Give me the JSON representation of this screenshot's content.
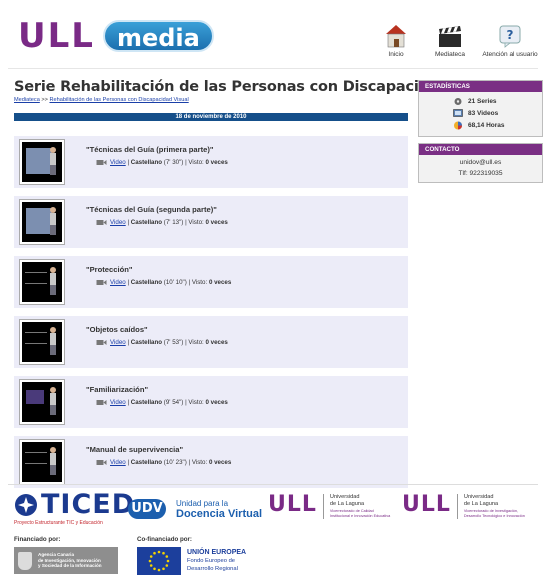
{
  "header": {
    "logo_ull": "ULL",
    "logo_media": "media",
    "nav": [
      {
        "label": "Inicio",
        "icon": "home-icon"
      },
      {
        "label": "Mediateca",
        "icon": "clapperboard-icon"
      },
      {
        "label": "Atención al usuario",
        "icon": "help-icon"
      }
    ]
  },
  "main": {
    "title": "Serie Rehabilitación de las Personas con Discapacidad Visual",
    "breadcrumb": {
      "home": "Mediateca",
      "separator": ">>",
      "current": "Rehabilitación de las Personas con Discapacidad Visual"
    },
    "date": "18 de noviembre de 2010",
    "items": [
      {
        "title": "\"Técnicas del Guía (primera parte)\"",
        "link": "Video",
        "lang": "Castellano",
        "duration": "(7' 30\")",
        "views_label": "Visto:",
        "views": "0 veces",
        "thumb": "thumb-guia-1"
      },
      {
        "title": "\"Técnicas del Guía (segunda parte)\"",
        "link": "Video",
        "lang": "Castellano",
        "duration": "(7' 13\")",
        "views_label": "Visto:",
        "views": "0 veces",
        "thumb": "thumb-guia-2"
      },
      {
        "title": "\"Protección\"",
        "link": "Video",
        "lang": "Castellano",
        "duration": "(10' 10\")",
        "views_label": "Visto:",
        "views": "0 veces",
        "thumb": "thumb-proteccion"
      },
      {
        "title": "\"Objetos caídos\"",
        "link": "Video",
        "lang": "Castellano",
        "duration": "(7' 53\")",
        "views_label": "Visto:",
        "views": "0 veces",
        "thumb": "thumb-objetos"
      },
      {
        "title": "\"Familiarización\"",
        "link": "Video",
        "lang": "Castellano",
        "duration": "(9' 54\")",
        "views_label": "Visto:",
        "views": "0 veces",
        "thumb": "thumb-familiarizacion"
      },
      {
        "title": "\"Manual de supervivencia\"",
        "link": "Video",
        "lang": "Castellano",
        "duration": "(10' 23\")",
        "views_label": "Visto:",
        "views": "0 veces",
        "thumb": "thumb-manual"
      }
    ]
  },
  "sidebar": {
    "stats_title": "ESTADÍSTICAS",
    "stats": [
      {
        "icon": "series-icon",
        "text": "21 Series"
      },
      {
        "icon": "videos-icon",
        "text": "83 Videos"
      },
      {
        "icon": "hours-icon",
        "text": "68,14 Horas"
      }
    ],
    "contact_title": "CONTACTO",
    "email": "unidov@ull.es",
    "phone": "Tlf: 922319035"
  },
  "footer": {
    "ticed": "TICED",
    "ticed_sub": "Proyecto Estructurante TIC y Educación",
    "udv_mark": "UDV",
    "udv_l1": "Unidad para la",
    "udv_l2": "Docencia Virtual",
    "ull_mark": "ULL",
    "ull1_l1": "Universidad",
    "ull1_l2": "de La Laguna",
    "ull1_sub1": "Vicerrectorado de Calidad",
    "ull1_sub2": "Institucional e Innovación Educativa",
    "ull2_l1": "Universidad",
    "ull2_l2": "de La Laguna",
    "ull2_sub1": "Vicerrectorado de Investigación,",
    "ull2_sub2": "Desarrollo Tecnológico e Innovación",
    "financed_label": "Financiado por:",
    "agency_l1": "Agencia Canaria",
    "agency_l2": "de Investigación, Innovación",
    "agency_l3": "y Sociedad de la Información",
    "cofinanced_label": "Co-financiado por:",
    "eu_l1": "UNIÓN EUROPEA",
    "eu_l2": "Fondo Europeo de",
    "eu_l3": "Desarrollo Regional"
  },
  "colors": {
    "brand_purple": "#7a2f84",
    "brand_blue": "#154f8a",
    "item_bg": "#ececf8",
    "link": "#1a3fa8"
  }
}
